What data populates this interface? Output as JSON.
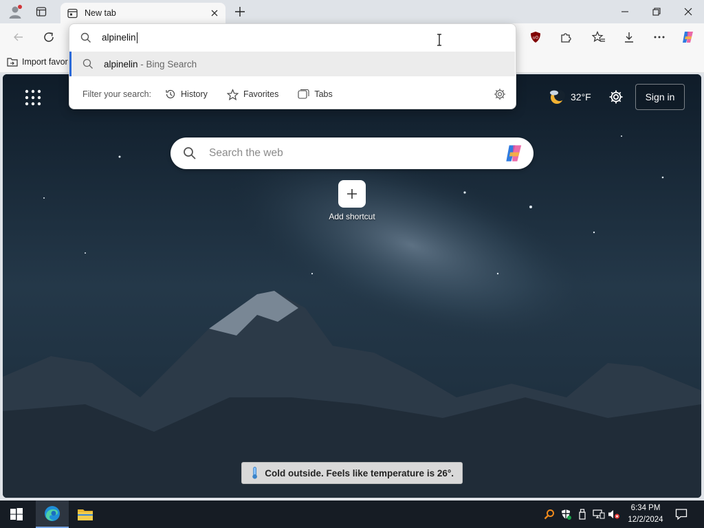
{
  "tabs": [
    {
      "label": "New tab",
      "icon": "new-tab-page-icon",
      "active": true
    }
  ],
  "favorites_bar": {
    "import_label": "Import favor"
  },
  "omnibox": {
    "query": "alpinelin",
    "suggestion": {
      "text": "alpinelin",
      "suffix": " - Bing Search"
    },
    "filter_label": "Filter your search:",
    "filters": [
      {
        "label": "History",
        "icon": "history-icon"
      },
      {
        "label": "Favorites",
        "icon": "star-icon"
      },
      {
        "label": "Tabs",
        "icon": "tabs-icon"
      }
    ]
  },
  "ntp": {
    "weather_temp": "32°F",
    "signin_label": "Sign in",
    "search_placeholder": "Search the web",
    "add_shortcut_label": "Add shortcut"
  },
  "notification": {
    "text": "Cold outside. Feels like temperature is 26°."
  },
  "taskbar": {
    "time": "6:34 PM",
    "date": "12/2/2024"
  },
  "colors": {
    "accent": "#2b6ad8",
    "taskbar": "#161c24",
    "chrome": "#dfe3e8"
  }
}
